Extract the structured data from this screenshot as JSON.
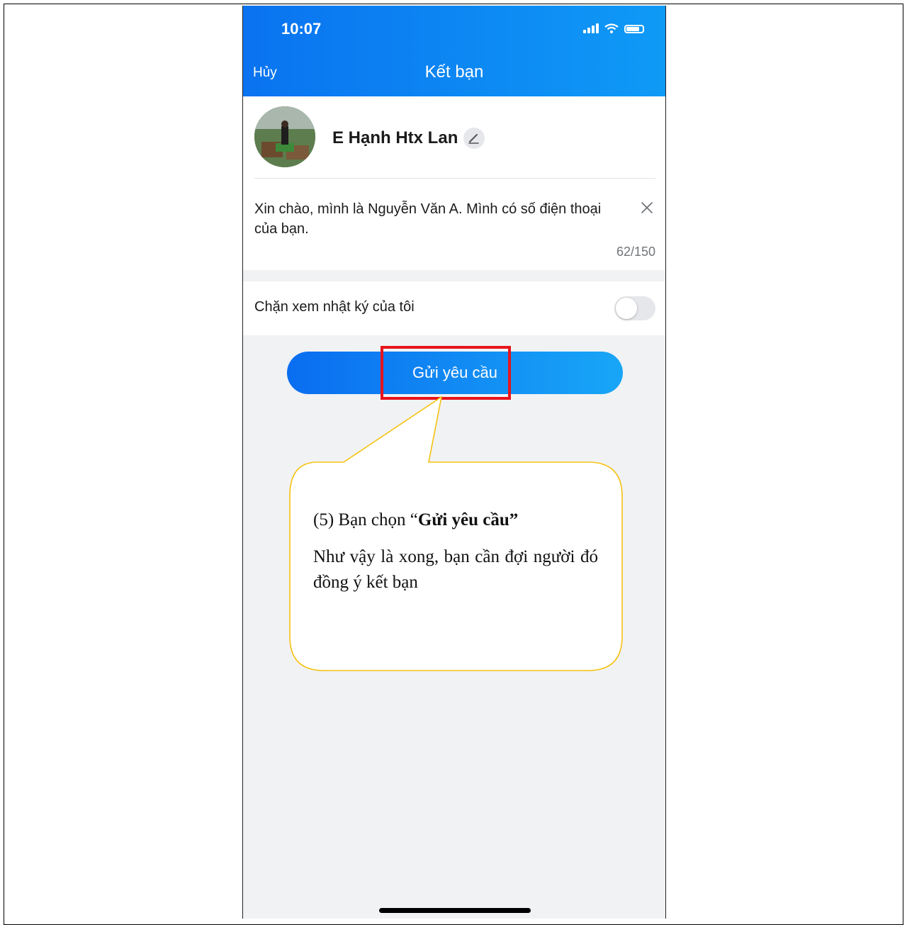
{
  "status_bar": {
    "time": "10:07"
  },
  "header": {
    "cancel_label": "Hủy",
    "title": "Kết bạn"
  },
  "profile": {
    "name": "E Hạnh Htx Lan"
  },
  "message": {
    "text": "Xin chào, mình là Nguyễn Văn A. Mình có số điện thoại của bạn.",
    "counter": "62/150"
  },
  "block_diary": {
    "label": "Chặn xem nhật ký của tôi",
    "enabled": false
  },
  "send_button": {
    "label": "Gửi yêu cầu"
  },
  "callout": {
    "step_prefix": "(5) Bạn chọn “",
    "step_bold": "Gửi yêu cầu”",
    "description": "Như vậy là xong, bạn cần đợi người đó đồng ý kết bạn"
  },
  "colors": {
    "header_start": "#0a73f0",
    "header_end": "#0f9af6",
    "highlight": "#e8141b",
    "callout_border": "#f5c211"
  }
}
